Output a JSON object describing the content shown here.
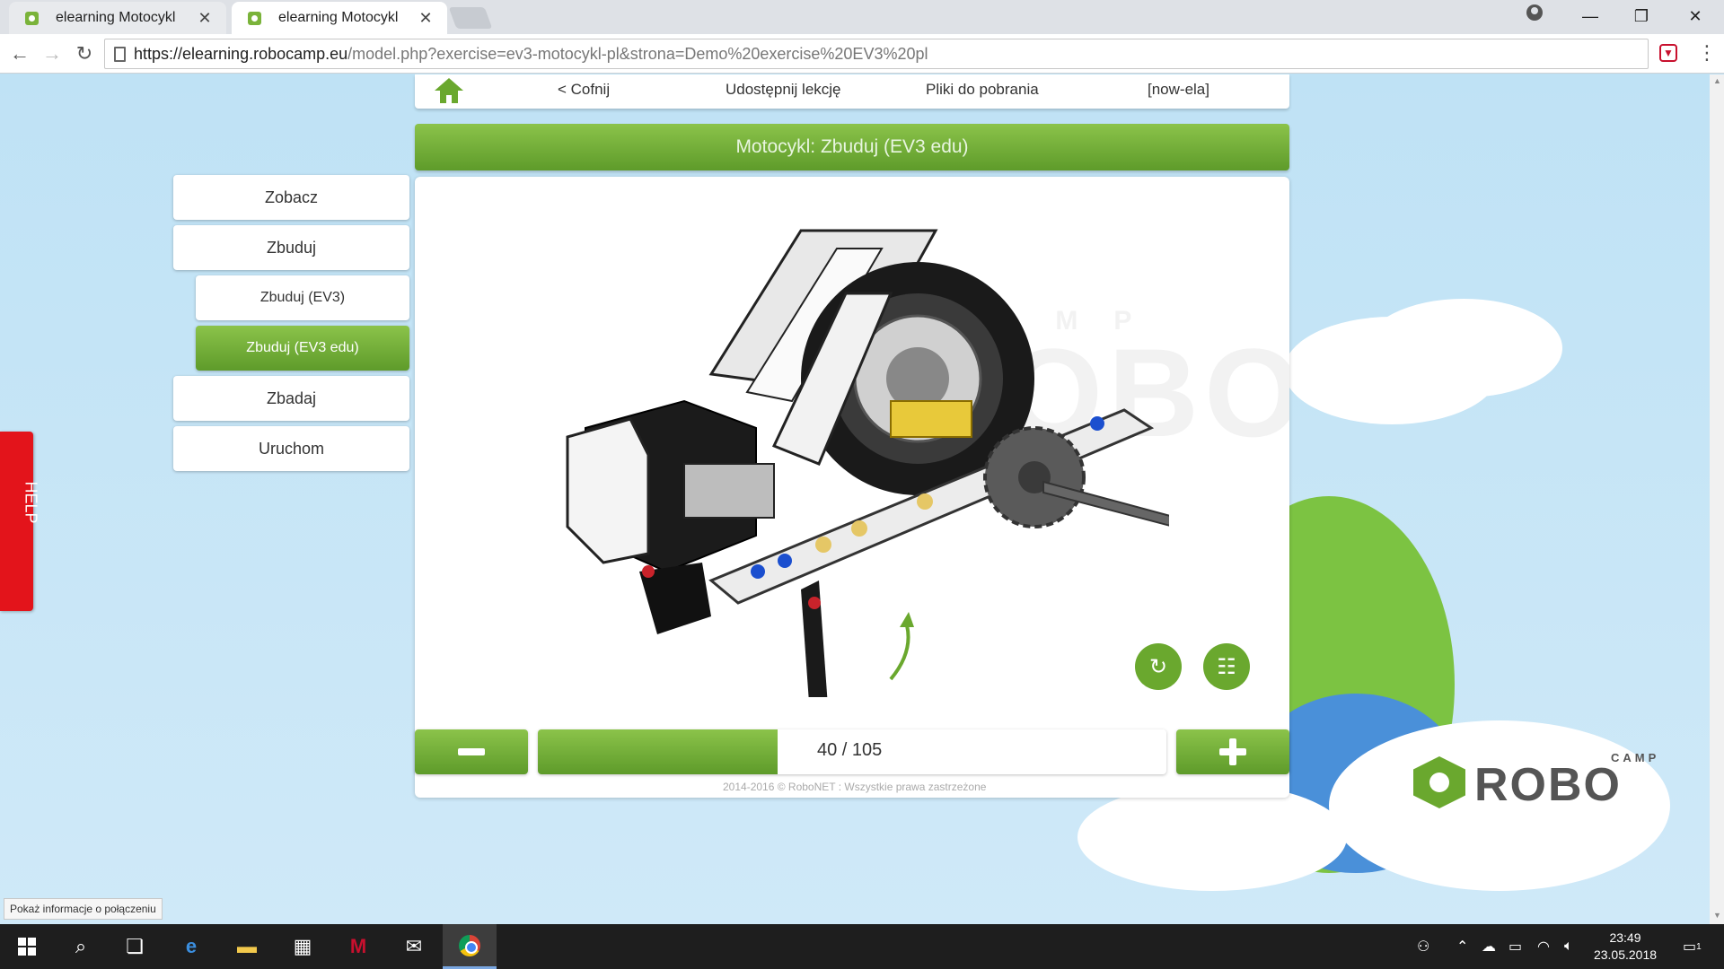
{
  "browser": {
    "tabs": [
      {
        "label": "elearning Motocykl",
        "active": false
      },
      {
        "label": "elearning Motocykl",
        "active": true
      }
    ],
    "tab_close": "✕",
    "url_host": "https://elearning.robocamp.eu",
    "url_path": "/model.php?exercise=ev3-motocykl-pl&strona=Demo%20exercise%20EV3%20pl"
  },
  "page": {
    "nav": {
      "back": "< Cofnij",
      "share": "Udostępnij lekcję",
      "downloads": "Pliki do pobrania",
      "user": "[now-ela]"
    },
    "title": "Motocykl: Zbuduj (EV3 edu)",
    "sidebar": {
      "items": [
        {
          "label": "Zobacz",
          "sub": false,
          "selected": false
        },
        {
          "label": "Zbuduj",
          "sub": false,
          "selected": false
        },
        {
          "label": "Zbuduj (EV3)",
          "sub": true,
          "selected": false
        },
        {
          "label": "Zbuduj (EV3 edu)",
          "sub": true,
          "selected": true
        },
        {
          "label": "Zbadaj",
          "sub": false,
          "selected": false
        },
        {
          "label": "Uruchom",
          "sub": false,
          "selected": false
        }
      ]
    },
    "viewer": {
      "watermark": "ROBO",
      "watermark_sub": "CAMP"
    },
    "steps": {
      "current": 40,
      "total": 105,
      "counter_text": "40 / 105",
      "progress_fraction": 0.381
    },
    "footer": "2014-2016 © RoboNET : Wszystkie prawa zastrzeżone",
    "help": "HELP",
    "logo": {
      "camp": "CAMP",
      "robo": "ROBO"
    },
    "status_tip": "Pokaż informacje o połączeniu"
  },
  "taskbar": {
    "time": "23:49",
    "date": "23.05.2018",
    "notification_count": "1"
  },
  "colors": {
    "green_light": "#8bc34a",
    "green_dark": "#5e9b2a",
    "help_red": "#e3141b"
  }
}
